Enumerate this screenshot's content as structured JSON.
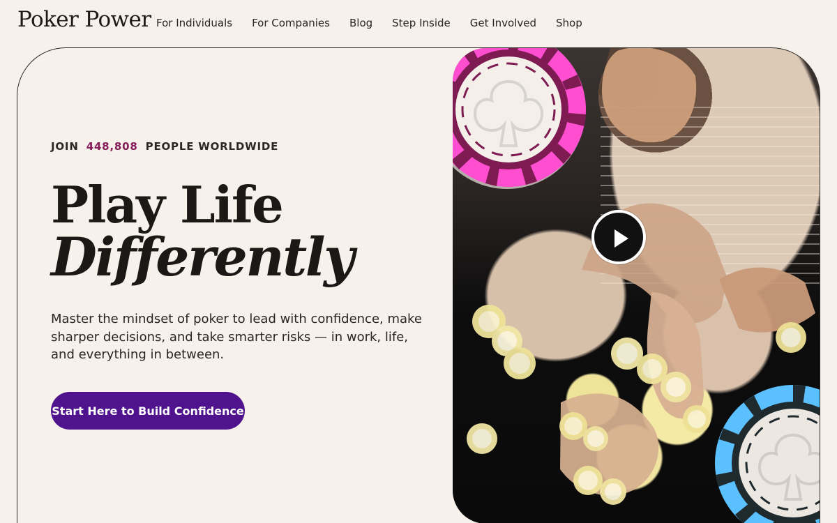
{
  "logo": "Poker Power",
  "nav": [
    "For Individuals",
    "For Companies",
    "Blog",
    "Step Inside",
    "Get Involved",
    "Shop"
  ],
  "hero": {
    "eyebrow_prefix": "JOIN",
    "count": "448,808",
    "eyebrow_suffix": "PEOPLE WORLDWIDE",
    "headline_line1": "Play Life",
    "headline_line2": "Differently",
    "body": "Master the mindset of poker to lead with confidence, make sharper decisions, and take smarter risks — in work, life, and everything in between.",
    "cta": "Start Here to Build Confidence"
  },
  "media": {
    "play_icon": "play-icon",
    "top_chip": "magenta-poker-chip",
    "bottom_chip": "blue-poker-chip"
  },
  "colors": {
    "background": "#f6f1ea",
    "text": "#1f1b17",
    "accent_count": "#861c5a",
    "cta": "#4f148d",
    "chip_pink": "#ff4fd0",
    "chip_maroon": "#7d1b52",
    "chip_blue": "#5bc0ff",
    "chip_dark": "#1f2a2e"
  }
}
